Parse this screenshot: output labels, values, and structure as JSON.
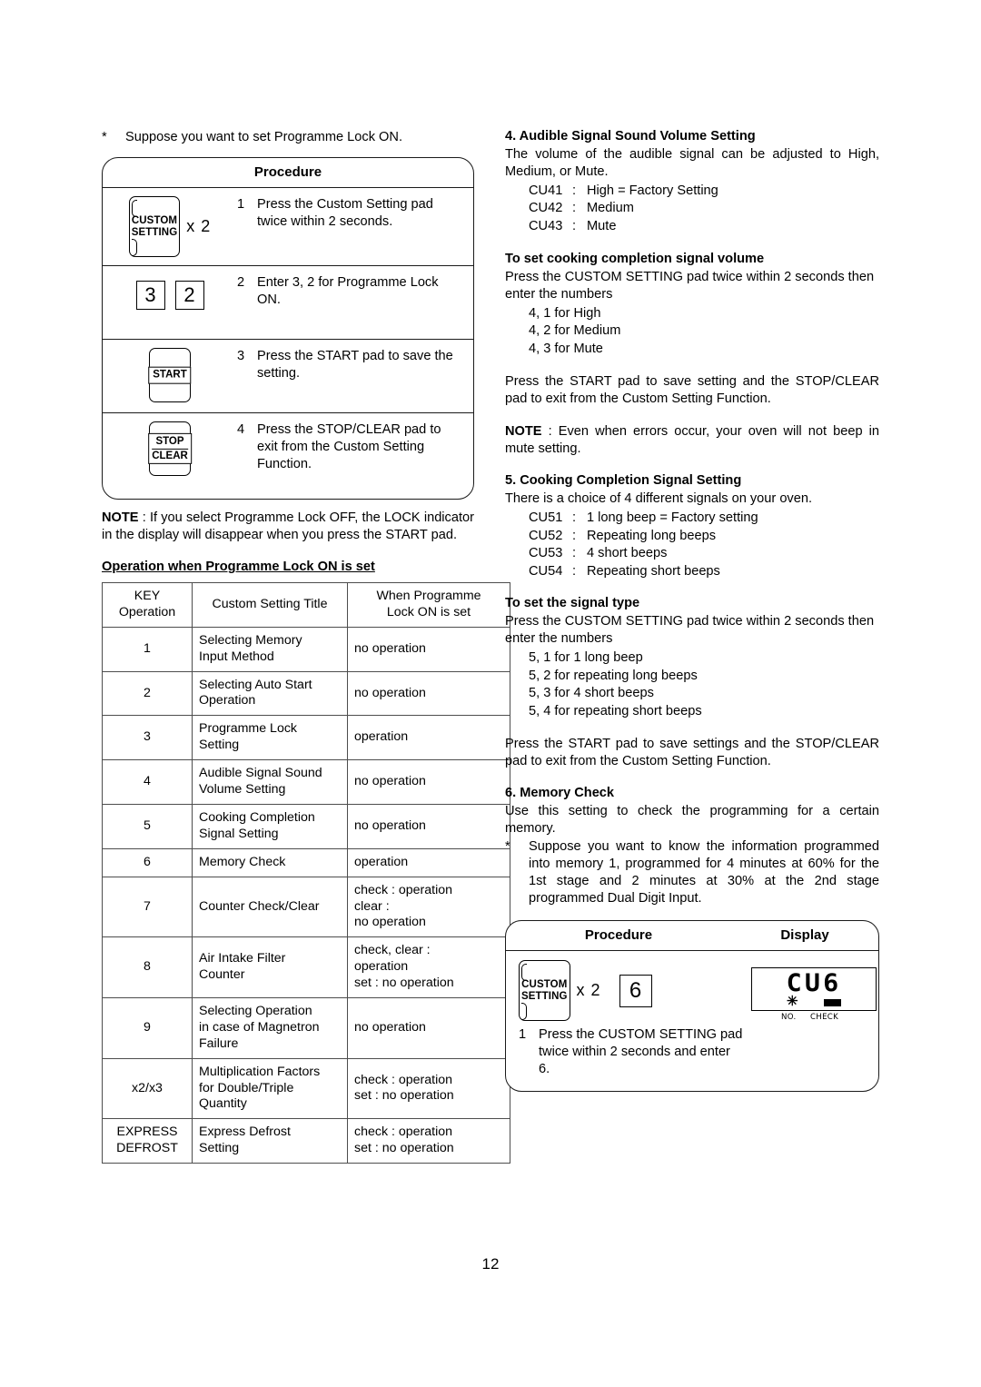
{
  "page_number": "12",
  "left": {
    "intro_star": "*",
    "intro_text": "Suppose you want to set Programme Lock ON.",
    "procedure": {
      "header": "Procedure",
      "steps": [
        {
          "num": "1",
          "key_type": "custom-setting-x2",
          "key_line1": "CUSTOM",
          "key_line2": "SETTING",
          "multiplier": "x 2",
          "text": "Press the Custom Setting pad twice within 2 seconds."
        },
        {
          "num": "2",
          "key_type": "digits",
          "digit1": "3",
          "digit2": "2",
          "text": "Enter 3, 2 for Programme Lock ON."
        },
        {
          "num": "3",
          "key_type": "start",
          "key_label": "START",
          "text": "Press the START pad to save the setting."
        },
        {
          "num": "4",
          "key_type": "stop-clear",
          "key_line1": "STOP",
          "key_line2": "CLEAR",
          "text": "Press the STOP/CLEAR pad to exit from the Custom Setting Function."
        }
      ]
    },
    "note_label": "NOTE",
    "note_text": " : If you select Programme Lock OFF, the LOCK indicator in the display will disappear when you press the START pad.",
    "table_heading": "Operation when Programme Lock ON is set",
    "table": {
      "headers": {
        "key_l1": "KEY",
        "key_l2": "Operation",
        "title": "Custom Setting Title",
        "when_l1": "When Programme",
        "when_l2": "Lock ON is set"
      },
      "rows": [
        {
          "key": "1",
          "title": "Selecting Memory\nInput Method",
          "when": "no operation"
        },
        {
          "key": "2",
          "title": "Selecting Auto Start\nOperation",
          "when": "no operation"
        },
        {
          "key": "3",
          "title": "Programme Lock\nSetting",
          "when": "operation"
        },
        {
          "key": "4",
          "title": "Audible Signal Sound\nVolume Setting",
          "when": "no operation"
        },
        {
          "key": "5",
          "title": "Cooking Completion\nSignal Setting",
          "when": "no operation"
        },
        {
          "key": "6",
          "title": "Memory Check",
          "when": "operation"
        },
        {
          "key": "7",
          "title": "Counter Check/Clear",
          "when": "check : operation\nclear :\nno operation"
        },
        {
          "key": "8",
          "title": "Air Intake Filter\nCounter",
          "when": "check, clear :\noperation\nset : no operation"
        },
        {
          "key": "9",
          "title": "Selecting Operation\nin case of Magnetron\nFailure",
          "when": "no operation"
        },
        {
          "key": "x2/x3",
          "title": "Multiplication Factors\nfor Double/Triple\nQuantity",
          "when": "check : operation\nset : no operation"
        },
        {
          "key": "EXPRESS\nDEFROST",
          "title": "Express Defrost\nSetting",
          "when": "check : operation\nset : no operation"
        }
      ]
    }
  },
  "right": {
    "section4": {
      "heading": "4. Audible Signal Sound Volume Setting",
      "intro": "The volume of the audible signal can be adjusted to High, Medium, or Mute.",
      "codes": [
        {
          "code": "CU41",
          "colon": ":",
          "desc": "High = Factory Setting"
        },
        {
          "code": "CU42",
          "colon": ":",
          "desc": "Medium"
        },
        {
          "code": "CU43",
          "colon": ":",
          "desc": "Mute"
        }
      ],
      "sub_heading": "To set cooking completion signal volume",
      "sub_intro": "Press the CUSTOM SETTING pad twice within 2 seconds then enter the numbers",
      "sub_items": [
        "4, 1 for High",
        "4, 2 for Medium",
        "4, 3 for Mute"
      ],
      "save_text": "Press the START pad to save setting and the STOP/CLEAR pad to exit from the Custom Setting Function.",
      "note_label": "NOTE",
      "note_text": " : Even when errors occur, your oven will not beep in mute setting."
    },
    "section5": {
      "heading": "5. Cooking Completion Signal Setting",
      "intro": "There is a choice of  4 different signals on your oven.",
      "codes": [
        {
          "code": "CU51",
          "colon": ":",
          "desc": "1 long beep = Factory setting"
        },
        {
          "code": "CU52",
          "colon": ":",
          "desc": "Repeating long beeps"
        },
        {
          "code": "CU53",
          "colon": ":",
          "desc": "4 short beeps"
        },
        {
          "code": "CU54",
          "colon": ":",
          "desc": "Repeating short beeps"
        }
      ],
      "sub_heading": "To set the signal type",
      "sub_intro": "Press the CUSTOM SETTING pad twice within 2 seconds then enter the numbers",
      "sub_items": [
        "5, 1 for 1 long beep",
        "5, 2 for repeating long beeps",
        "5, 3 for 4 short beeps",
        "5, 4 for repeating short beeps"
      ],
      "save_text": "Press the START pad to save settings and the STOP/CLEAR pad to exit from the Custom Setting Function."
    },
    "section6": {
      "heading": "6. Memory Check",
      "intro": "Use this setting to check the programming for a certain memory.",
      "star": "*",
      "star_text": "Suppose you want to know the information programmed into memory 1, programmed for 4 minutes at 60% for the 1st stage and 2 minutes at 30% at the 2nd stage programmed Dual Digit Input.",
      "box": {
        "header_procedure": "Procedure",
        "header_display": "Display",
        "key_line1": "CUSTOM",
        "key_line2": "SETTING",
        "multiplier": "x 2",
        "digit": "6",
        "step_num": "1",
        "step_text": "Press the CUSTOM SETTING pad twice within 2 seconds and enter 6.",
        "display": {
          "digits": "CU6",
          "star_marker": "✳",
          "label_no": "NO.",
          "label_check": "CHECK"
        }
      }
    }
  }
}
